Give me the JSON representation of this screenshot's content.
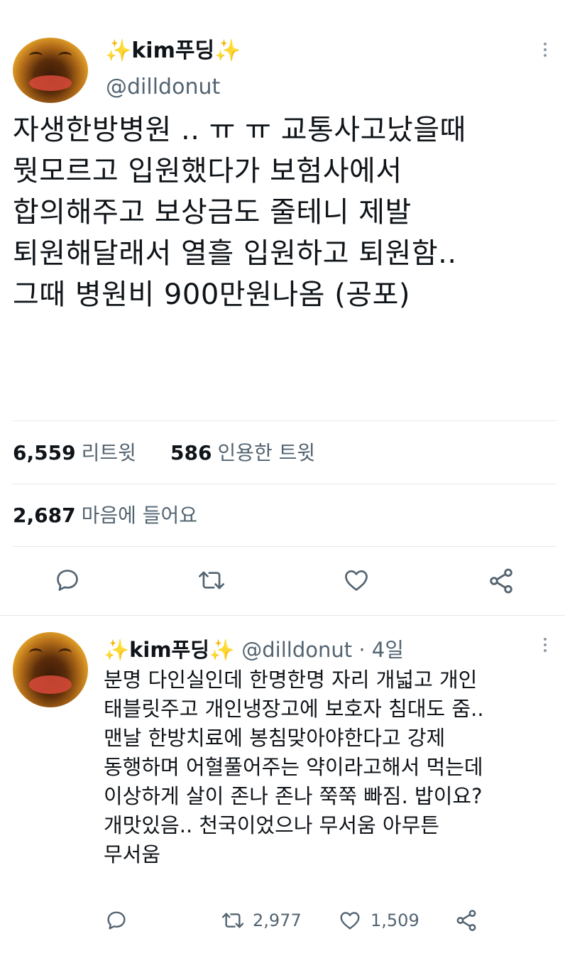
{
  "tweet": {
    "display_name": "kim푸딩",
    "handle": "@dilldonut",
    "sparkle": "✨",
    "text_lines": [
      "자생한방병원 .. ㅠ ㅠ 교통사고났을때",
      "뭣모르고 입원했다가 보험사에서",
      "합의해주고 보상금도 줄테니 제발",
      "퇴원해달래서 열흘 입원하고 퇴원함..",
      "그때 병원비 900만원나옴 (공포)"
    ],
    "retweets_count": "6,559",
    "retweets_label": "리트윗",
    "quotes_count": "586",
    "quotes_label": "인용한 트윗",
    "likes_count": "2,687",
    "likes_label": "마음에 들어요"
  },
  "reply": {
    "display_name": "kim푸딩",
    "handle": "@dilldonut",
    "separator": "·",
    "time": "4일",
    "text_lines": [
      "분명 다인실인데 한명한명 자리 개넓고 개인",
      "태블릿주고 개인냉장고에 보호자 침대도 줌..",
      "맨날 한방치료에 봉침맞아야한다고 강제",
      "동행하며 어혈풀어주는 약이라고해서 먹는데",
      "이상하게 살이 존나 존나 쭉쭉 빠짐. 밥이요?",
      "개맛있음.. 천국이었으나 무서움 아무튼",
      "무서움"
    ],
    "retweet_count": "2,977",
    "like_count": "1,509"
  },
  "icons": {
    "reply": "reply-icon",
    "retweet": "retweet-icon",
    "like": "heart-icon",
    "share": "share-icon",
    "more": "more-icon"
  },
  "colors": {
    "text": "#0f1419",
    "muted": "#536471",
    "divider": "#e5e8eb",
    "sparkle": "#f5b800"
  }
}
